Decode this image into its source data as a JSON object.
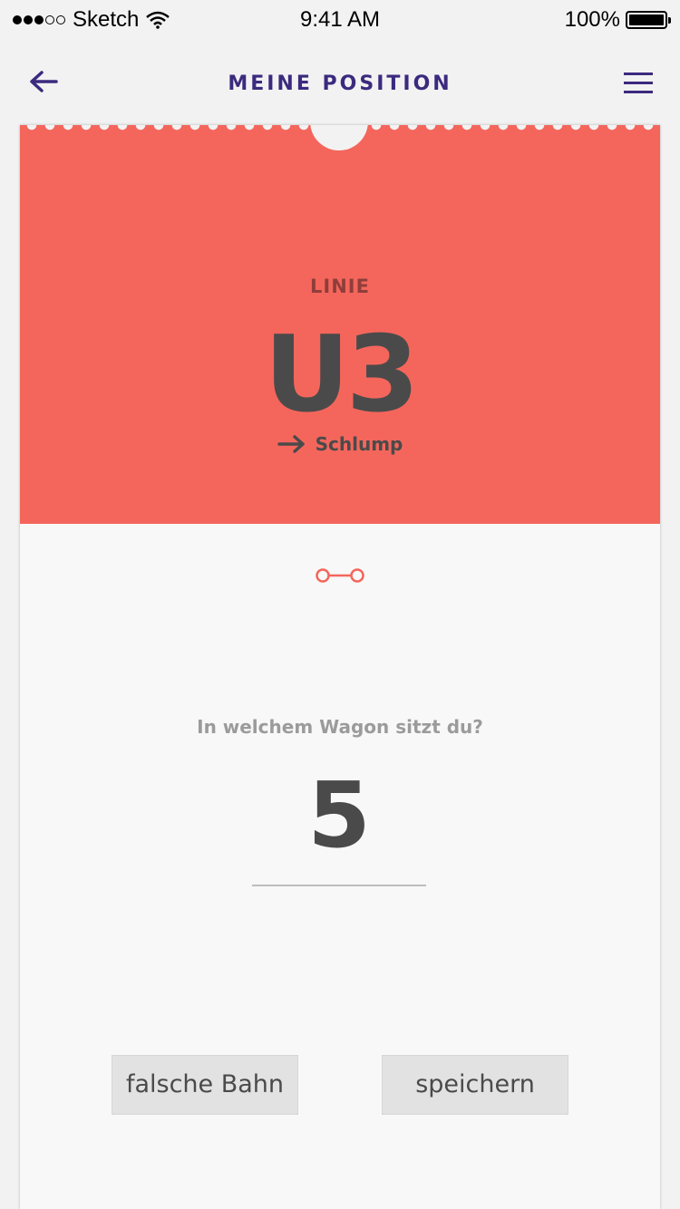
{
  "status_bar": {
    "carrier": "Sketch",
    "time": "9:41 AM",
    "battery": "100%"
  },
  "nav": {
    "title": "MEINE POSITION",
    "back_icon": "arrow-left-icon",
    "menu_icon": "hamburger-menu-icon"
  },
  "ticket": {
    "line_label": "LINIE",
    "line_number": "U3",
    "direction": "Schlump",
    "direction_icon": "arrow-right-icon",
    "wagon_icon": "wagon-coupling-icon"
  },
  "wagon_prompt": {
    "question": "In welchem Wagon sitzt du?",
    "value": "5"
  },
  "buttons": {
    "wrong_train": "falsche Bahn",
    "save": "speichern"
  },
  "colors": {
    "accent": "#3b2a7e",
    "ticket_red": "#f4665c",
    "text_dark": "#4a4a4a",
    "text_muted": "#9b9b9b"
  }
}
